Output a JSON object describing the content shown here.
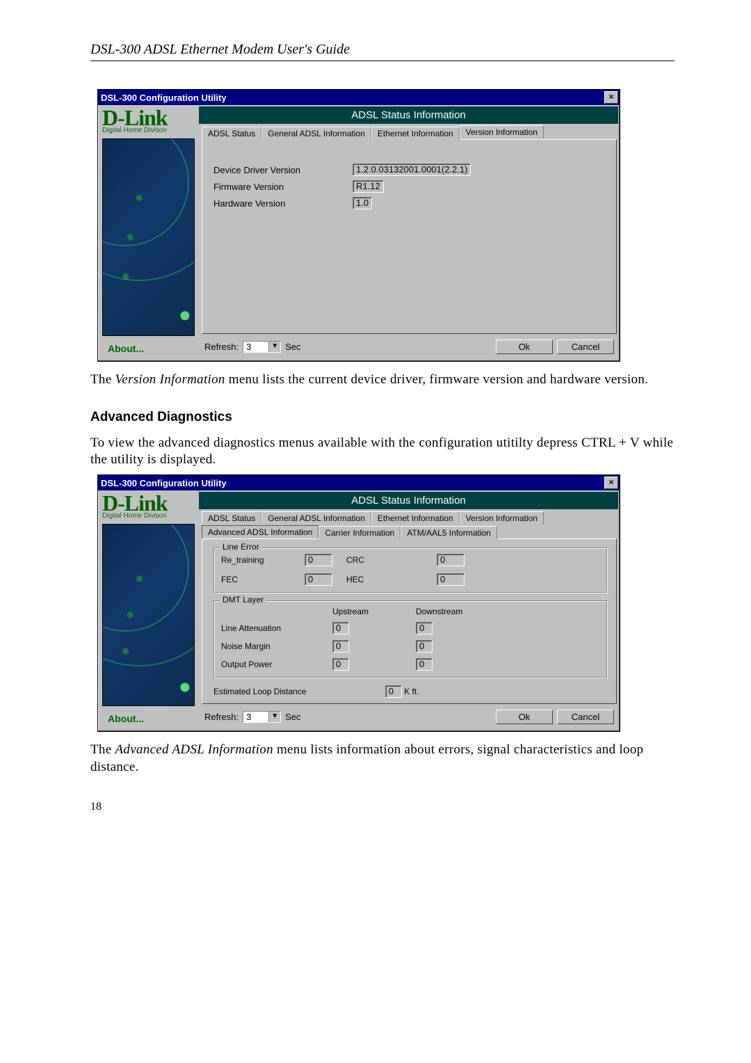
{
  "doc": {
    "title": "DSL-300 ADSL Ethernet Modem User's Guide",
    "p1_a": "The ",
    "p1_ital": "Version Information",
    "p1_b": " menu lists the current device driver, firmware version and hardware version.",
    "section": "Advanced Diagnostics",
    "p2": "To view the advanced diagnostics menus available with the configuration utitilty depress CTRL + V while the utility is displayed.",
    "p3_a": "The ",
    "p3_ital": "Advanced ADSL Information",
    "p3_b": " menu lists information about errors, signal characteristics and loop distance.",
    "page_number": "18"
  },
  "dlg": {
    "title": "DSL-300 Configuration Utility",
    "brand_main": "D-Link",
    "brand_sub": "Digital Home Divison",
    "about": "About...",
    "info_header": "ADSL Status Information",
    "tabs": {
      "adsl_status": "ADSL Status",
      "general": "General ADSL Information",
      "ethernet": "Ethernet Information",
      "version": "Version Information",
      "advanced": "Advanced ADSL Information",
      "carrier": "Carrier Information",
      "atm": "ATM/AAL5 Information"
    },
    "footer": {
      "refresh_label": "Refresh:",
      "refresh_value": "3",
      "sec": "Sec",
      "ok": "Ok",
      "cancel": "Cancel"
    }
  },
  "version_panel": {
    "driver_label": "Device Driver Version",
    "driver_value": "1.2.0.03132001.0001(2.2.1)",
    "fw_label": "Firmware Version",
    "fw_value": "R1.12",
    "hw_label": "Hardware Version",
    "hw_value": "1.0"
  },
  "adv_panel": {
    "line_error_legend": "Line Error",
    "re_training": "Re_training",
    "re_training_val": "0",
    "crc": "CRC",
    "crc_val": "0",
    "fec": "FEC",
    "fec_val": "0",
    "hec": "HEC",
    "hec_val": "0",
    "dmt_legend": "DMT Layer",
    "upstream": "Upstream",
    "downstream": "Downstream",
    "line_atten": "Line Attenuation",
    "line_atten_up": "0",
    "line_atten_down": "0",
    "noise_margin": "Noise Margin",
    "noise_margin_up": "0",
    "noise_margin_down": "0",
    "output_power": "Output Power",
    "output_power_up": "0",
    "output_power_down": "0",
    "loop_label": "Estimated  Loop Distance",
    "loop_value": "0",
    "loop_unit": "K ft."
  }
}
